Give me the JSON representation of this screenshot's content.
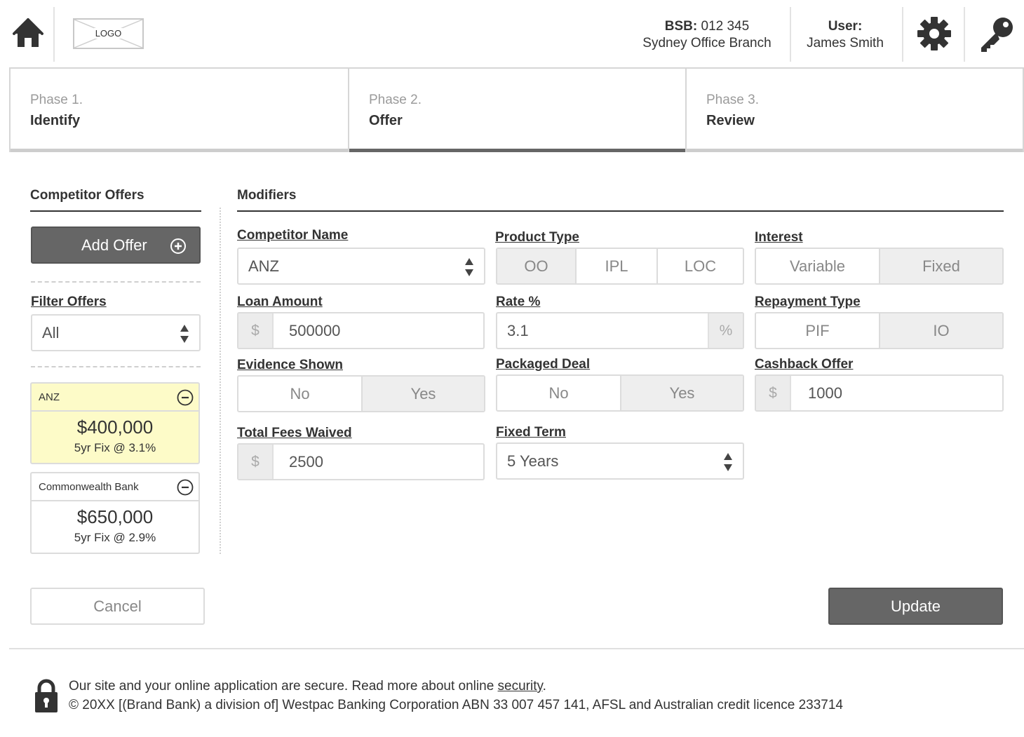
{
  "header": {
    "logo_text": "LOGO",
    "bsb_label": "BSB:",
    "bsb_value": "012 345",
    "branch_name": "Sydney Office Branch",
    "user_label": "User:",
    "user_name": "James Smith",
    "icons": [
      "home-icon",
      "gear-icon",
      "key-icon"
    ]
  },
  "phases": [
    {
      "num": "Phase 1.",
      "name": "Identify",
      "active": false
    },
    {
      "num": "Phase 2.",
      "name": "Offer",
      "active": true
    },
    {
      "num": "Phase 3.",
      "name": "Review",
      "active": false
    }
  ],
  "competitor_offers": {
    "title": "Competitor Offers",
    "add_offer_label": "Add Offer",
    "filter_label": "Filter Offers",
    "filter_value": "All",
    "offers": [
      {
        "bank": "ANZ",
        "amount": "$400,000",
        "terms": "5yr Fix @ 3.1%",
        "selected": true
      },
      {
        "bank": "Commonwealth Bank",
        "amount": "$650,000",
        "terms": "5yr Fix @ 2.9%",
        "selected": false
      }
    ]
  },
  "modifiers": {
    "title": "Modifiers",
    "competitor_name": {
      "label": "Competitor Name",
      "value": "ANZ"
    },
    "product_type": {
      "label": "Product Type",
      "options": [
        "OO",
        "IPL",
        "LOC"
      ],
      "selected": "OO"
    },
    "interest": {
      "label": "Interest",
      "options": [
        "Variable",
        "Fixed"
      ],
      "selected": "Fixed"
    },
    "loan_amount": {
      "label": "Loan Amount",
      "prefix": "$",
      "value": "500000"
    },
    "rate": {
      "label": "Rate %",
      "value": "3.1",
      "suffix": "%"
    },
    "repayment_type": {
      "label": "Repayment Type",
      "options": [
        "PIF",
        "IO"
      ],
      "selected": "IO"
    },
    "evidence_shown": {
      "label": "Evidence Shown",
      "options": [
        "No",
        "Yes"
      ],
      "selected": "Yes"
    },
    "packaged_deal": {
      "label": "Packaged Deal",
      "options": [
        "No",
        "Yes"
      ],
      "selected": "Yes"
    },
    "cashback_offer": {
      "label": "Cashback Offer",
      "prefix": "$",
      "value": "1000"
    },
    "total_fees_waived": {
      "label": "Total Fees Waived",
      "prefix": "$",
      "value": "2500"
    },
    "fixed_term": {
      "label": "Fixed Term",
      "value": "5 Years"
    }
  },
  "actions": {
    "cancel_label": "Cancel",
    "update_label": "Update"
  },
  "footer": {
    "secure_text": "Our site and your online application are secure. Read more about online ",
    "security_link": "security",
    "secure_end": ".",
    "copyright": "© 20XX [(Brand Bank) a division of] Westpac Banking Corporation ABN 33 007 457 141, AFSL and Australian credit licence 233714"
  },
  "colors": {
    "primary_button": "#666666",
    "selected_card": "#fdfbc8",
    "segment_selected": "#eeeeee",
    "border": "#dcdcdc"
  }
}
